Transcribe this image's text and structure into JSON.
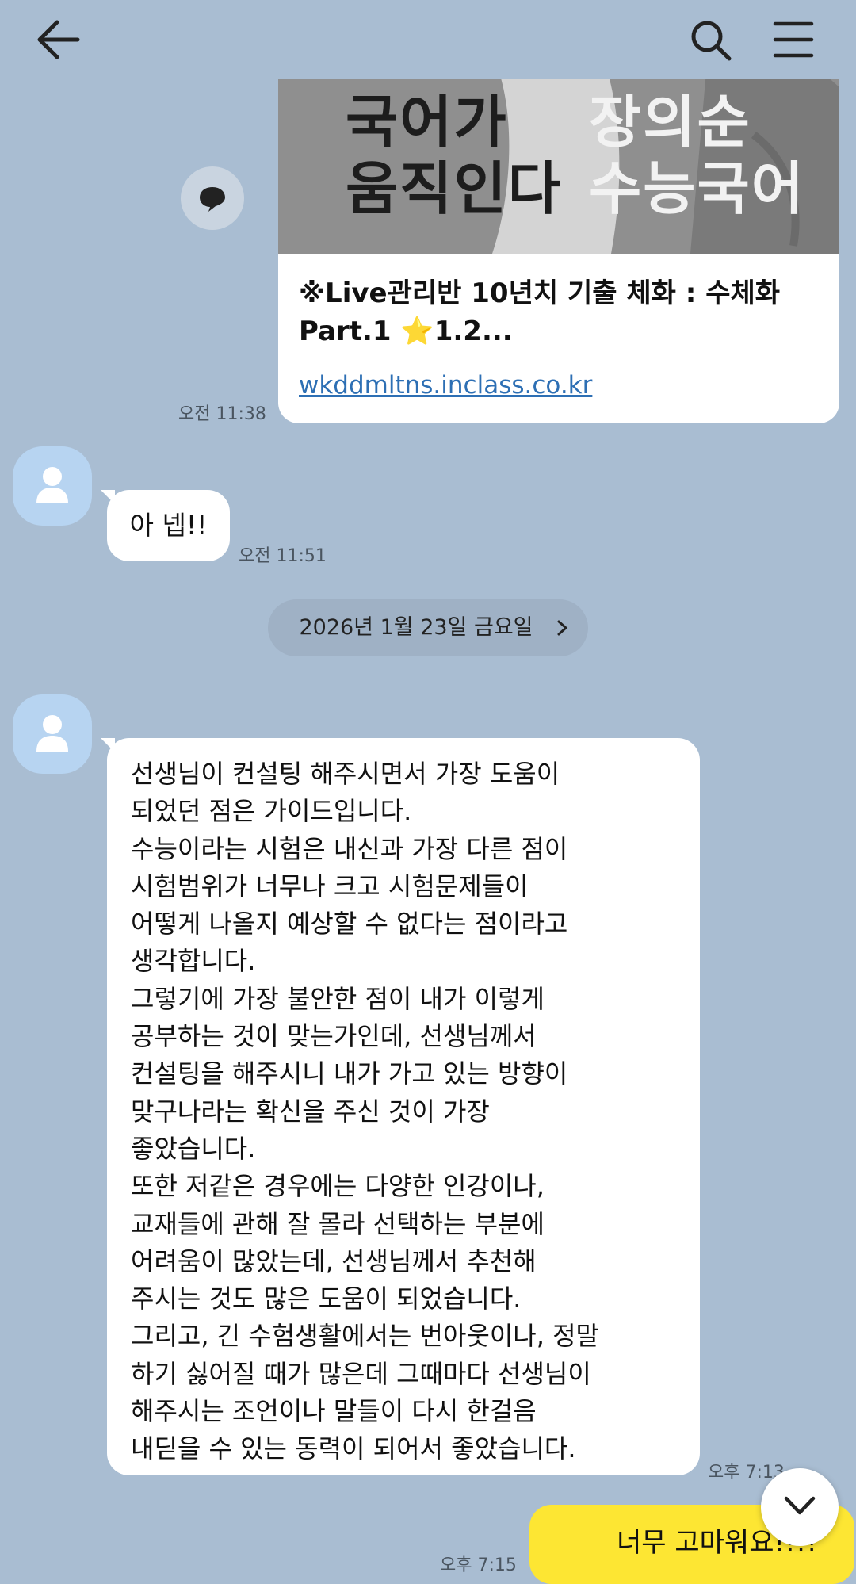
{
  "header": {
    "back_icon": "arrow-left-icon",
    "search_icon": "search-icon",
    "menu_icon": "hamburger-menu-icon"
  },
  "link_preview": {
    "thumbnail_text_left": "국어가\n움직인다",
    "thumbnail_text_right": "장의순\n수능국어",
    "title": "※Live관리반 10년치 기출 체화 : 수체화 Part.1 ⭐1.2...",
    "url": "wkddmltns.inclass.co.kr",
    "time": "오전 11:38"
  },
  "messages": [
    {
      "sender": "other",
      "text": "아 넵!!",
      "time": "오전 11:51"
    },
    {
      "sender": "other",
      "text": "선생님이 컨설팅 해주시면서 가장 도움이\n되었던 점은 가이드입니다.\n수능이라는 시험은 내신과 가장 다른 점이\n시험범위가 너무나 크고 시험문제들이\n어떻게 나올지 예상할 수 없다는 점이라고\n생각합니다.\n그렇기에 가장 불안한 점이 내가 이렇게\n공부하는 것이 맞는가인데, 선생님께서\n컨설팅을 해주시니 내가 가고 있는 방향이\n맞구나라는 확신을 주신 것이 가장\n좋았습니다.\n또한 저같은 경우에는 다양한 인강이나,\n교재들에 관해 잘 몰라 선택하는 부분에\n어려움이 많았는데, 선생님께서 추천해\n주시는 것도 많은 도움이 되었습니다.\n그리고, 긴 수험생활에서는 번아웃이나, 정말\n하기 싫어질 때가 많은데 그때마다 선생님이\n해주시는 조언이나 말들이 다시 한걸음\n내딛을 수 있는 동력이 되어서 좋았습니다.",
      "time": "오후 7:13"
    },
    {
      "sender": "me",
      "text": "너무 고마워요!!!!",
      "time": "오후 7:15"
    }
  ],
  "date_divider": {
    "label": "2026년 1월 23일 금요일",
    "icon": "chevron-right-icon"
  },
  "scroll_down_icon": "chevron-down-icon",
  "colors": {
    "background": "#a9bdd2",
    "my_bubble": "#fde633",
    "other_bubble": "#ffffff",
    "link": "#2d6fb4"
  }
}
